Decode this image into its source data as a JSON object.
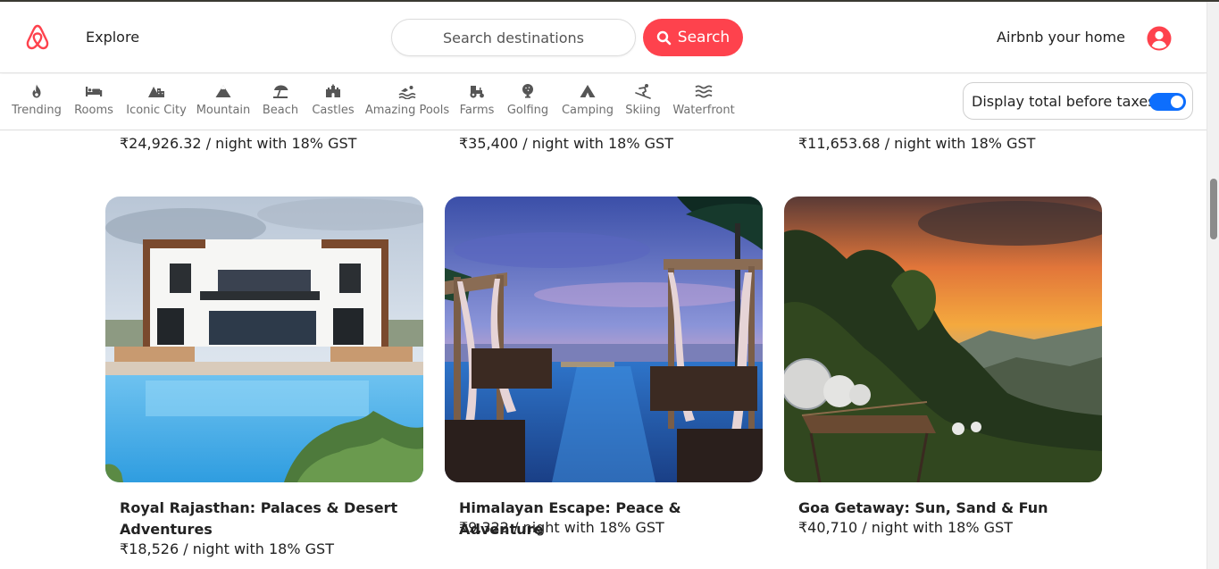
{
  "header": {
    "explore_label": "Explore",
    "search_placeholder": "Search destinations",
    "search_button_label": "Search",
    "host_label": "Airbnb your home",
    "brand_color": "#fe424d"
  },
  "filters": [
    {
      "label": "Trending",
      "icon": "fire-icon"
    },
    {
      "label": "Rooms",
      "icon": "bed-icon"
    },
    {
      "label": "Iconic City",
      "icon": "mountain-city-icon"
    },
    {
      "label": "Mountain",
      "icon": "mountain-icon"
    },
    {
      "label": "Beach",
      "icon": "umbrella-beach-icon"
    },
    {
      "label": "Castles",
      "icon": "castle-icon"
    },
    {
      "label": "Amazing Pools",
      "icon": "person-swimming-icon"
    },
    {
      "label": "Farms",
      "icon": "tractor-icon"
    },
    {
      "label": "Golfing",
      "icon": "golf-ball-icon"
    },
    {
      "label": "Camping",
      "icon": "campground-icon"
    },
    {
      "label": "Skiing",
      "icon": "person-skiing-icon"
    },
    {
      "label": "Waterfront",
      "icon": "water-icon"
    }
  ],
  "tax_toggle": {
    "label": "Display total before taxes",
    "enabled": true,
    "accent": "#0d6efd"
  },
  "previous_row_prices": [
    "₹24,926.32 / night with 18% GST",
    "₹35,400 / night with 18% GST",
    "₹11,653.68 / night with 18% GST"
  ],
  "listings": [
    {
      "title": "Royal Rajasthan: Palaces & Desert Adventures",
      "price": "₹18,526 / night with 18% GST"
    },
    {
      "title": "Himalayan Escape: Peace & Adventure",
      "price": "₹9,322 / night with 18% GST"
    },
    {
      "title": "Goa Getaway: Sun, Sand & Fun",
      "price": "₹40,710 / night with 18% GST"
    }
  ]
}
